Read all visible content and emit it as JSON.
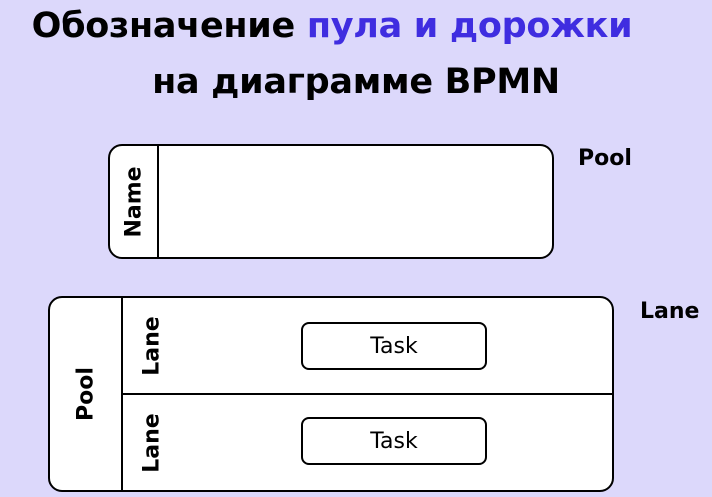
{
  "title": {
    "line1_prefix": "Обозначение ",
    "line1_accent": "пула и дорожки",
    "line2": "на диаграмме BPMN"
  },
  "colors": {
    "background": "#dcd8fb",
    "accent": "#3f2de0",
    "shape_fill": "#ffffff",
    "stroke": "#000000"
  },
  "pool_example": {
    "header_label": "Name",
    "side_label": "Pool"
  },
  "lane_example": {
    "pool_label": "Pool",
    "side_label": "Lane",
    "lanes": [
      {
        "label": "Lane",
        "task": "Task"
      },
      {
        "label": "Lane",
        "task": "Task"
      }
    ]
  }
}
